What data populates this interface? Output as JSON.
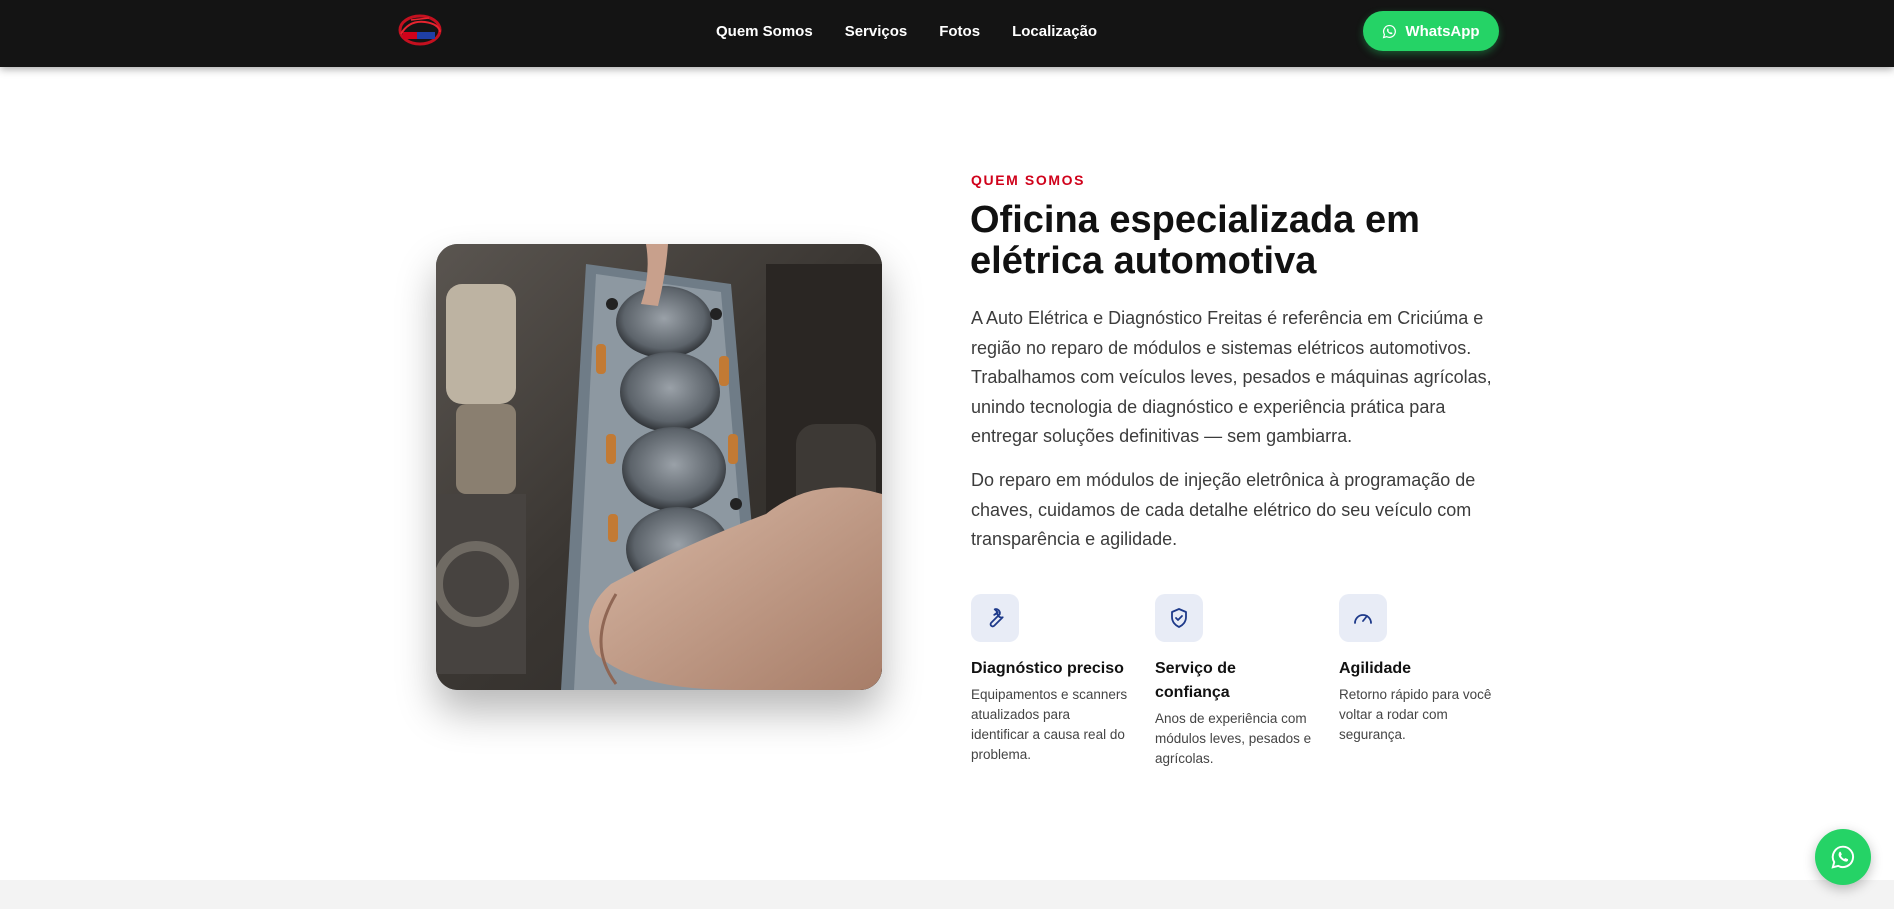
{
  "header": {
    "logo_alt": "Auto Elétrica e Diagnóstico Freitas logo",
    "nav": [
      "Quem Somos",
      "Serviços",
      "Fotos",
      "Localização"
    ],
    "cta_label": "WhatsApp"
  },
  "about": {
    "eyebrow": "QUEM SOMOS",
    "title": "Oficina especializada em elétrica automotiva",
    "paragraphs": [
      "A Auto Elétrica e Diagnóstico Freitas é referência em Criciúma e região no reparo de módulos e sistemas elétricos automotivos. Trabalhamos com veículos leves, pesados e máquinas agrícolas, unindo tecnologia de diagnóstico e experiência prática para entregar soluções definitivas — sem gambiarra.",
      "Do reparo em módulos de injeção eletrônica à programação de chaves, cuidamos de cada detalhe elétrico do seu veículo com transparência e agilidade."
    ],
    "features": [
      {
        "icon": "wrench-icon",
        "title": "Diagnóstico preciso",
        "desc": "Equipamentos e scanners atualizados para identificar a causa real do problema."
      },
      {
        "icon": "shield-check-icon",
        "title": "Serviço de confiança",
        "desc": "Anos de experiência com módulos leves, pesados e agrícolas."
      },
      {
        "icon": "speedometer-icon",
        "title": "Agilidade",
        "desc": "Retorno rápido para você voltar a rodar com segurança."
      }
    ]
  },
  "colors": {
    "accent": "#d0021b",
    "whatsapp": "#25d366",
    "header_bg": "#141414",
    "icon_bg": "#e8ecf6",
    "icon_stroke": "#1e3a8a"
  }
}
